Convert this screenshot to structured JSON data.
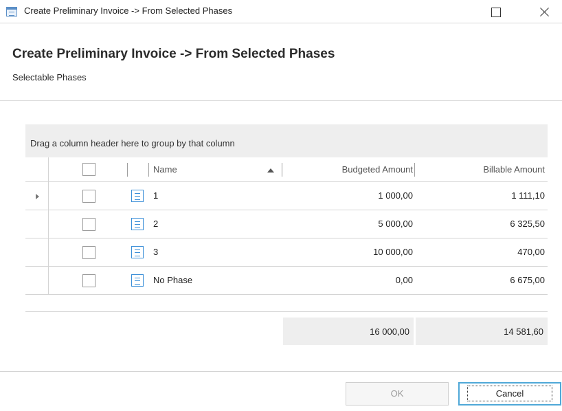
{
  "window": {
    "title": "Create Preliminary Invoice -> From Selected Phases",
    "icon": "form-window-icon",
    "controls": [
      "maximize-icon",
      "close-icon"
    ]
  },
  "header": {
    "heading": "Create Preliminary Invoice -> From Selected Phases",
    "subheading": "Selectable Phases"
  },
  "grid": {
    "group_panel_text": "Drag a column header here to group by that column",
    "columns": {
      "name": "Name",
      "budgeted": "Budgeted Amount",
      "billable": "Billable Amount"
    },
    "sort": {
      "column": "Name",
      "direction": "ascending"
    },
    "rows": [
      {
        "name": "1",
        "budgeted": "1 000,00",
        "billable": "1 111,10",
        "checked": false,
        "focused": true
      },
      {
        "name": "2",
        "budgeted": "5 000,00",
        "billable": "6 325,50",
        "checked": false,
        "focused": false
      },
      {
        "name": "3",
        "budgeted": "10 000,00",
        "billable": "470,00",
        "checked": false,
        "focused": false
      },
      {
        "name": "No Phase",
        "budgeted": "0,00",
        "billable": "6 675,00",
        "checked": false,
        "focused": false
      }
    ],
    "totals": {
      "budgeted": "16 000,00",
      "billable": "14 581,60"
    }
  },
  "buttons": {
    "ok": "OK",
    "cancel": "Cancel"
  },
  "colors": {
    "accent": "#4fa8d8",
    "icon_blue": "#3b8fd8",
    "group_panel_bg": "#eeeeee"
  }
}
